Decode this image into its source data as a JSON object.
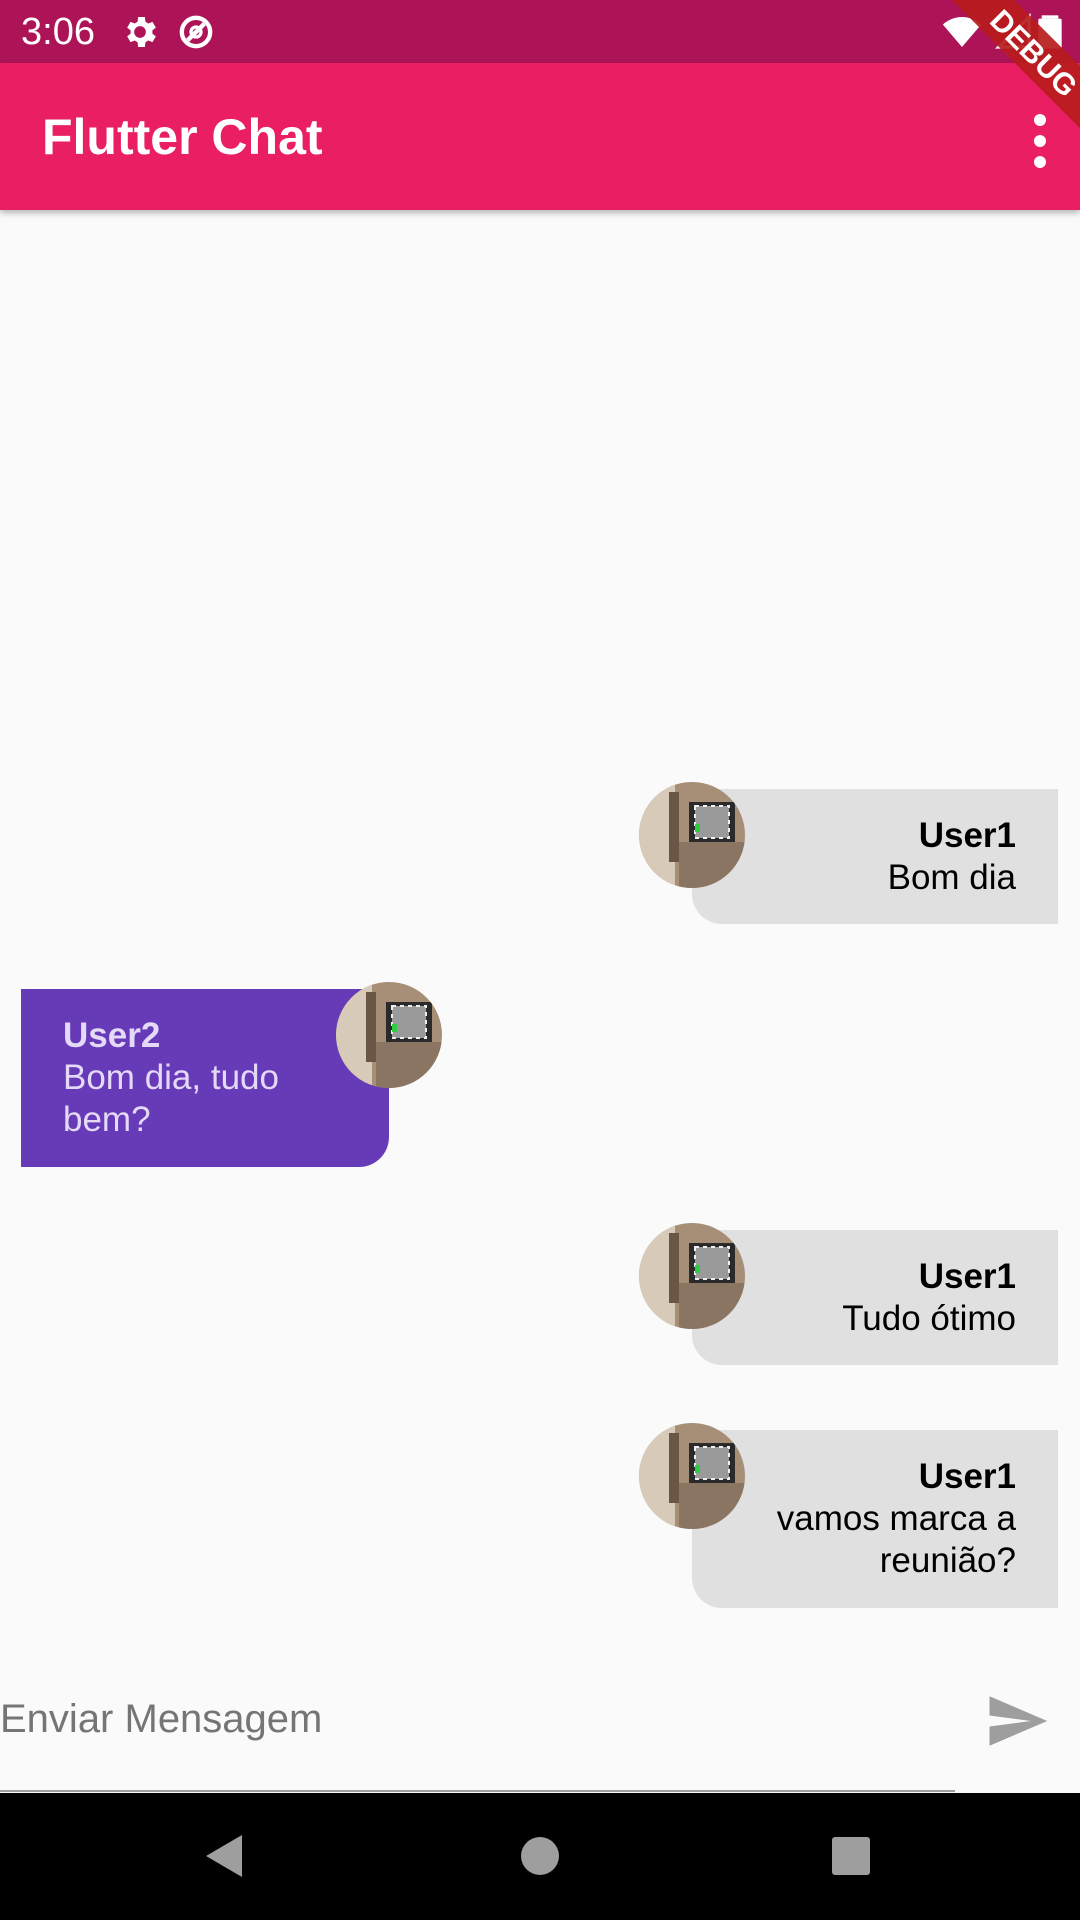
{
  "status_bar": {
    "time": "3:06",
    "icons": [
      "gear-icon",
      "data-saver-icon",
      "wifi-icon",
      "signal-icon",
      "battery-icon"
    ],
    "color": "#ad1457"
  },
  "app_bar": {
    "title": "Flutter Chat",
    "debug_banner": "DEBUG",
    "overflow_icon": "more-vert-icon",
    "color": "#e91e63"
  },
  "messages": [
    {
      "user": "User1",
      "text": "Bom dia",
      "side": "right",
      "avatar": "user1-avatar"
    },
    {
      "user": "User2",
      "text": "Bom dia, tudo bem?",
      "side": "left",
      "avatar": "user2-avatar"
    },
    {
      "user": "User1",
      "text": "Tudo ótimo",
      "side": "right",
      "avatar": "user1-avatar"
    },
    {
      "user": "User1",
      "text": "vamos marca a reunião?",
      "side": "right",
      "avatar": "user1-avatar"
    }
  ],
  "colors": {
    "own_bubble": "#e0e0e0",
    "other_bubble": "#673ab7",
    "other_text": "#e4d9f7"
  },
  "composer": {
    "placeholder": "Enviar Mensagem",
    "value": "",
    "send_icon": "send-icon"
  },
  "nav_bar": {
    "icons": [
      "back-icon",
      "home-icon",
      "recents-icon"
    ]
  }
}
